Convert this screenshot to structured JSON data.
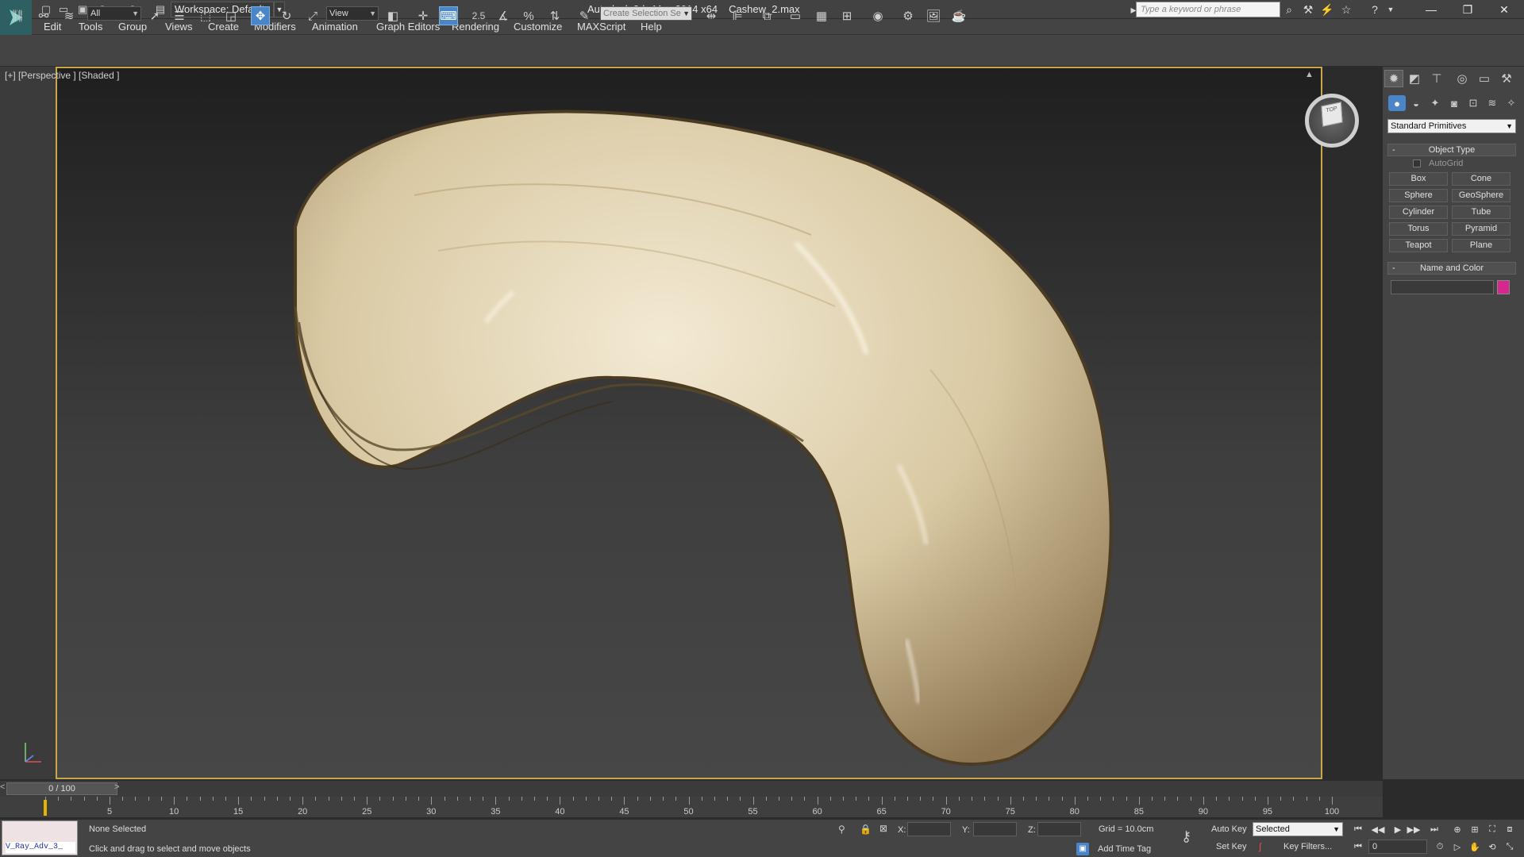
{
  "titlebar": {
    "workspace": "Workspace: Default",
    "app_name": "Autodesk 3ds Max  2014 x64",
    "file_name": "Cashew_2.max",
    "search_placeholder": "Type a keyword or phrase"
  },
  "menu": [
    "Edit",
    "Tools",
    "Group",
    "Views",
    "Create",
    "Modifiers",
    "Animation",
    "Graph Editors",
    "Rendering",
    "Customize",
    "MAXScript",
    "Help"
  ],
  "toolbar": {
    "selection_filter": "All",
    "reference_coord": "View",
    "snap_angle_label": "2.5",
    "named_selection": "Create Selection Se"
  },
  "viewport": {
    "label": "[+] [Perspective ] [Shaded ]",
    "viewcube_face": "TOP",
    "object_colors": {
      "base": "#d9c9a3",
      "highlight": "#f3ead4",
      "shadow": "#8c7550",
      "rim": "#4a3b22"
    },
    "border_color": "#c9a64a"
  },
  "command_panel": {
    "category": "Standard Primitives",
    "object_type_title": "Object Type",
    "autogrid": "AutoGrid",
    "primitives": [
      "Box",
      "Cone",
      "Sphere",
      "GeoSphere",
      "Cylinder",
      "Tube",
      "Torus",
      "Pyramid",
      "Teapot",
      "Plane"
    ],
    "name_color_title": "Name and Color",
    "object_color": "#d6278e"
  },
  "timeline": {
    "slider": "0 / 100",
    "ticks": [
      "5",
      "10",
      "15",
      "20",
      "25",
      "30",
      "35",
      "40",
      "45",
      "50",
      "55",
      "60",
      "65",
      "70",
      "75",
      "80",
      "85",
      "90",
      "95",
      "100"
    ]
  },
  "status": {
    "maxscript": "V_Ray_Adv_3_",
    "selection": "None Selected",
    "prompt": "Click and drag to select and move objects",
    "x_label": "X:",
    "y_label": "Y:",
    "z_label": "Z:",
    "grid": "Grid = 10.0cm",
    "add_time_tag": "Add Time Tag",
    "auto_key": "Auto Key",
    "set_key": "Set Key",
    "key_mode": "Selected",
    "key_filters": "Key Filters...",
    "frame": "0"
  }
}
